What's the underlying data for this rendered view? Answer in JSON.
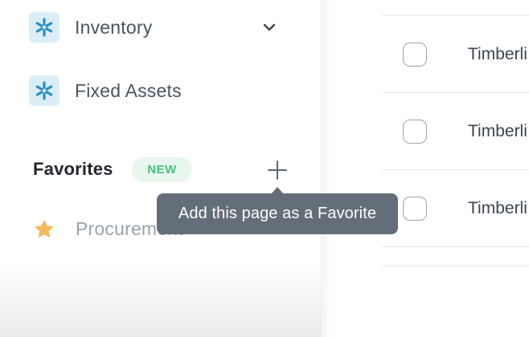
{
  "sidebar": {
    "items": [
      {
        "label": "Inventory",
        "icon": "asterisk-icon",
        "has_submenu": true
      },
      {
        "label": "Fixed Assets",
        "icon": "asterisk-icon",
        "has_submenu": false
      }
    ],
    "favorites": {
      "title": "Favorites",
      "badge": "NEW",
      "items": [
        {
          "label": "Procurement",
          "icon": "star-icon"
        }
      ]
    }
  },
  "tooltip": {
    "text": "Add this page as a Favorite"
  },
  "list": {
    "rows": [
      {
        "name": "Timberli",
        "checked": false
      },
      {
        "name": "Timberli",
        "checked": false
      },
      {
        "name": "Timberli",
        "checked": false
      }
    ]
  },
  "colors": {
    "icon_bg": "#dbeef8",
    "icon_fg": "#2a8fc4",
    "badge_bg": "#e8f6ee",
    "badge_fg": "#48c081",
    "star": "#f5b85a",
    "tooltip_bg": "#636e78"
  }
}
